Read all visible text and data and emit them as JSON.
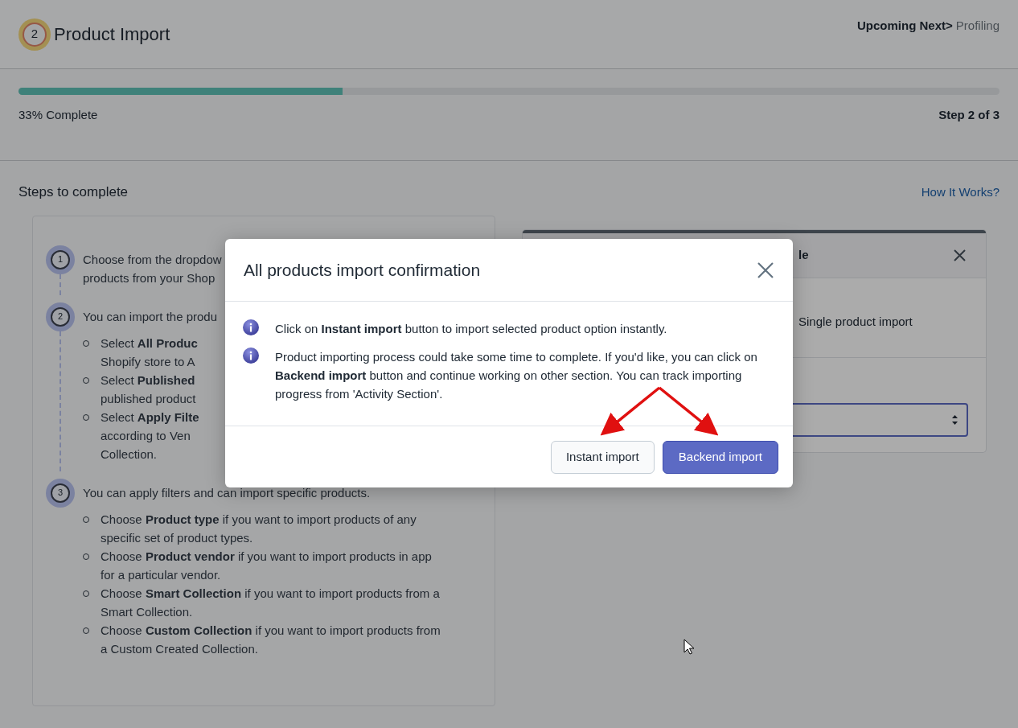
{
  "header": {
    "step_number": "2",
    "title": "Product Import",
    "upcoming_label": "Upcoming Next>",
    "upcoming_value": "Profiling"
  },
  "progress": {
    "level": 0.33,
    "label": "33% Complete",
    "step": "Step 2 of 3"
  },
  "steps_section": {
    "title": "Steps to complete",
    "help_link": "How It Works?",
    "steps": [
      {
        "number": "1",
        "lines": [
          "Choose from the dropdow",
          "products from your Shop"
        ]
      },
      {
        "number": "2",
        "lines": [
          "You can import the produ"
        ],
        "bullets": [
          {
            "lines": [
              "Select **All Produc**",
              "Shopify store to A"
            ]
          },
          {
            "lines": [
              "Select **Published**",
              "published product"
            ]
          },
          {
            "lines": [
              "Select **Apply Filte**",
              "according to Ven",
              "Collection."
            ]
          }
        ]
      },
      {
        "number": "3",
        "lines": [
          "You can apply filters and can import specific products."
        ],
        "bullets": [
          {
            "lines": [
              "Choose **Product type** if you want to import products of any specific set of product types."
            ]
          },
          {
            "lines": [
              "Choose **Product vendor** if you want to import products in app for a particular vendor."
            ]
          },
          {
            "lines": [
              "Choose **Smart Collection** if you want to import products from a Smart Collection."
            ]
          },
          {
            "lines": [
              "Choose **Custom Collection** if you want to import products from a Custom Created Collection."
            ]
          }
        ]
      }
    ]
  },
  "right_card": {
    "title": "le",
    "option": "Single product import"
  },
  "modal": {
    "title": "All products import confirmation",
    "notes": [
      "Click on **Instant import** button to import selected product option instantly.",
      "Product importing process could take some time to complete. If you'd like, you can click on **Backend import** button and continue working on other section. You can track importing progress from 'Activity Section'."
    ],
    "buttons": [
      {
        "label": "Instant import",
        "kind": "secondary"
      },
      {
        "label": "Backend import",
        "kind": "primary"
      }
    ]
  }
}
